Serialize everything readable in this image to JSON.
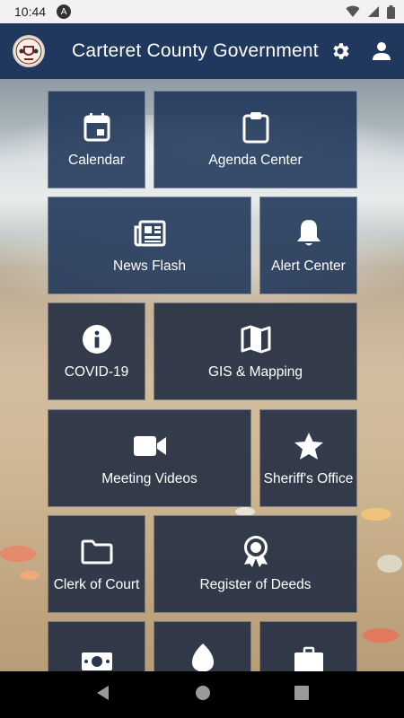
{
  "status_bar": {
    "time": "10:44",
    "notification_badge": "A"
  },
  "app_bar": {
    "title": "Carteret County Government",
    "logo_icon": "county-seal-icon",
    "settings_icon": "gear-icon",
    "profile_icon": "person-icon"
  },
  "tiles": [
    {
      "label": "Calendar",
      "icon": "calendar-icon"
    },
    {
      "label": "Agenda Center",
      "icon": "clipboard-icon"
    },
    {
      "label": "News Flash",
      "icon": "newspaper-icon"
    },
    {
      "label": "Alert Center",
      "icon": "bell-icon"
    },
    {
      "label": "COVID-19",
      "icon": "info-icon"
    },
    {
      "label": "GIS & Mapping",
      "icon": "map-icon"
    },
    {
      "label": "Meeting Videos",
      "icon": "video-camera-icon"
    },
    {
      "label": "Sheriff's Office",
      "icon": "star-icon"
    },
    {
      "label": "Clerk of Court",
      "icon": "folder-icon"
    },
    {
      "label": "Register of Deeds",
      "icon": "award-ribbon-icon"
    },
    {
      "label": "",
      "icon": "money-icon"
    },
    {
      "label": "",
      "icon": "leaf-icon"
    },
    {
      "label": "",
      "icon": "briefcase-icon"
    }
  ],
  "colors": {
    "app_bar": "#20385e",
    "tile_blue": "#1e3458",
    "tile_dark": "#222d42"
  }
}
